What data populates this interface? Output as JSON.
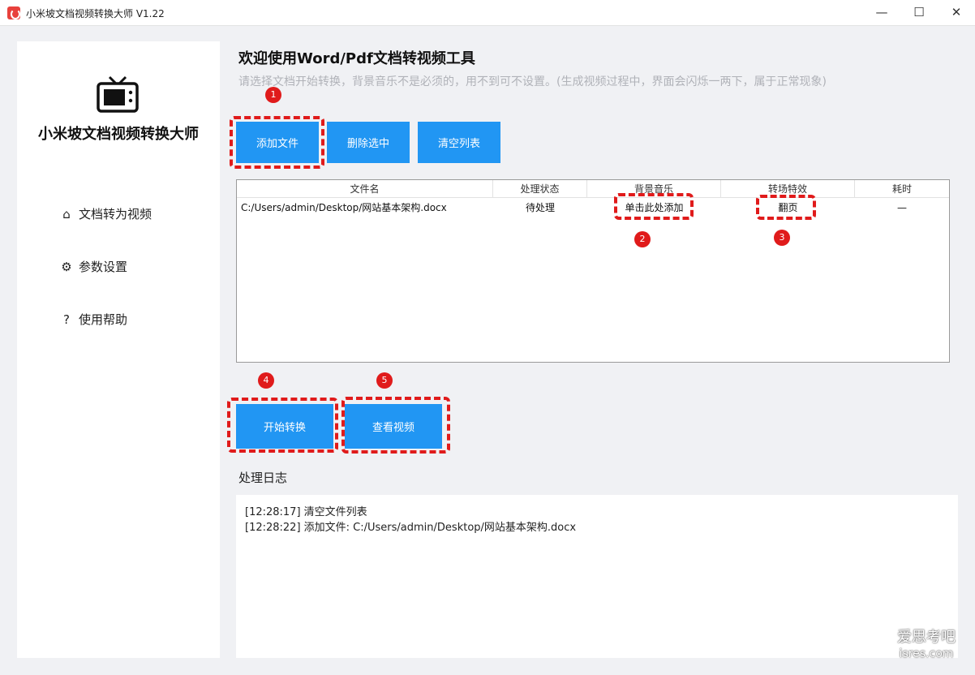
{
  "window": {
    "title": "小米坡文档视频转换大师 V1.22",
    "minimize": "—",
    "maximize": "☐",
    "close": "✕"
  },
  "sidebar": {
    "brand": "小米坡文档视频转换大师",
    "items": [
      {
        "label": "文档转为视频",
        "icon": "⌂"
      },
      {
        "label": "参数设置",
        "icon": "⚙"
      },
      {
        "label": "使用帮助",
        "icon": "?"
      }
    ]
  },
  "main": {
    "title": "欢迎使用Word/Pdf文档转视频工具",
    "subtitle": "请选择文档开始转换，背景音乐不是必须的，用不到可不设置。(生成视频过程中，界面会闪烁一两下，属于正常现象)",
    "toolbar": {
      "add": "添加文件",
      "delete": "删除选中",
      "clear": "清空列表"
    },
    "table": {
      "columns": [
        "文件名",
        "处理状态",
        "背景音乐",
        "转场特效",
        "耗时"
      ],
      "rows": [
        {
          "file": "C:/Users/admin/Desktop/网站基本架构.docx",
          "status": "待处理",
          "music": "单击此处添加",
          "effect": "翻页",
          "time": "—"
        }
      ]
    },
    "actions": {
      "start": "开始转换",
      "view": "查看视频"
    },
    "log": {
      "title": "处理日志",
      "lines": [
        "[12:28:17] 清空文件列表",
        "[12:28:22] 添加文件: C:/Users/admin/Desktop/网站基本架构.docx"
      ]
    },
    "badges": [
      "1",
      "2",
      "3",
      "4",
      "5"
    ]
  },
  "watermark": {
    "line1": "爱思考吧",
    "line2": "isres.com"
  }
}
